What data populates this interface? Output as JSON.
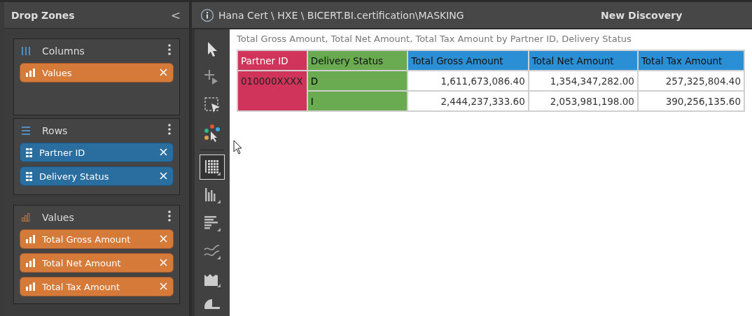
{
  "sidebar": {
    "title": "Drop Zones",
    "collapse_label": "<",
    "zones": [
      {
        "title": "Columns",
        "kind": "columns",
        "items": [
          {
            "label": "Values",
            "kind": "measure"
          }
        ]
      },
      {
        "title": "Rows",
        "kind": "rows",
        "items": [
          {
            "label": "Partner ID",
            "kind": "dimension"
          },
          {
            "label": "Delivery Status",
            "kind": "dimension"
          }
        ]
      },
      {
        "title": "Values",
        "kind": "values",
        "items": [
          {
            "label": "Total Gross Amount",
            "kind": "measure"
          },
          {
            "label": "Total Net Amount",
            "kind": "measure"
          },
          {
            "label": "Total Tax Amount",
            "kind": "measure"
          }
        ]
      }
    ]
  },
  "header": {
    "path": "Hana Cert \\ HXE \\ BICERT.BI.certification\\MASKING",
    "title": "New Discovery"
  },
  "toolbar": [
    {
      "kind": "pointer",
      "selected": false
    },
    {
      "kind": "add",
      "selected": false
    },
    {
      "kind": "marquee",
      "selected": false
    },
    {
      "kind": "colors",
      "selected": false
    },
    {
      "kind": "grid",
      "selected": true
    },
    {
      "kind": "columns",
      "selected": false
    },
    {
      "kind": "bars",
      "selected": false
    },
    {
      "kind": "lines",
      "selected": false
    },
    {
      "kind": "area",
      "selected": false
    },
    {
      "kind": "pie",
      "selected": false
    }
  ],
  "report": {
    "caption": "Total Gross Amount, Total Net Amount, Total Tax Amount by Partner ID, Delivery Status",
    "columns": [
      {
        "label": "Partner ID",
        "color": "#d0345a"
      },
      {
        "label": "Delivery Status",
        "color": "#6aaa50"
      },
      {
        "label": "Total Gross Amount",
        "color": "#2b8fd6"
      },
      {
        "label": "Total Net Amount",
        "color": "#2b8fd6"
      },
      {
        "label": "Total Tax Amount",
        "color": "#2b8fd6"
      }
    ],
    "groups": [
      {
        "partner_id": "010000XXXX",
        "rows": [
          {
            "status": "D",
            "values": [
              "1,611,673,086.40",
              "1,354,347,282.00",
              "257,325,804.40"
            ]
          },
          {
            "status": "I",
            "values": [
              "2,444,237,333.60",
              "2,053,981,198.00",
              "390,256,135.60"
            ]
          }
        ]
      }
    ]
  }
}
